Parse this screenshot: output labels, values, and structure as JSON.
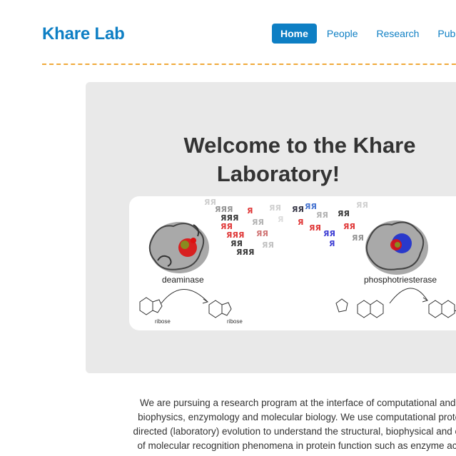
{
  "header": {
    "brand": "Khare Lab",
    "nav": [
      {
        "label": "Home",
        "active": true
      },
      {
        "label": "People",
        "active": false
      },
      {
        "label": "Research",
        "active": false
      },
      {
        "label": "Pub",
        "active": false
      }
    ]
  },
  "colors": {
    "accent": "#0e7fc4",
    "divider": "#f0a93a",
    "hero_background": "#e9e9e9"
  },
  "hero": {
    "title_line1": "Welcome to the Khare",
    "title_line2": "Laboratory!",
    "figure": {
      "left_enzyme": "deaminase",
      "right_enzyme": "phosphotriesterase",
      "substrate_left": "ribose",
      "product_left": "ribose"
    }
  },
  "intro": {
    "lines": [
      "We are pursuing a research program at the interface of computational and exp",
      "biophysics, enzymology and molecular biology. We use computational protein d",
      "directed (laboratory) evolution to understand the structural, biophysical and evolut",
      "of molecular recognition phenomena in protein function such as enzyme activity"
    ]
  }
}
